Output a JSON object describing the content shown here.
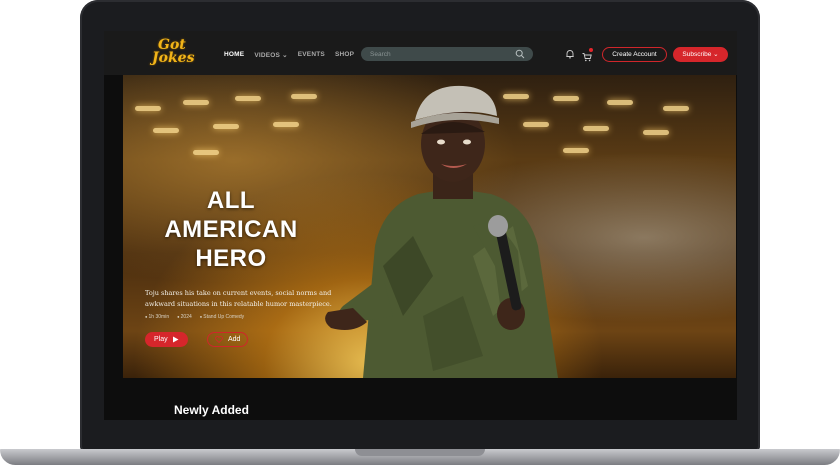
{
  "brand": {
    "logo_line1": "Got",
    "logo_line2": "Jokes"
  },
  "nav": {
    "items": [
      {
        "label": "HOME",
        "active": true
      },
      {
        "label": "VIDEOS ⌄",
        "active": false
      },
      {
        "label": "EVENTS",
        "active": false
      },
      {
        "label": "SHOP",
        "active": false
      }
    ]
  },
  "search": {
    "placeholder": "Search"
  },
  "header": {
    "create_account_label": "Create Account",
    "subscribe_label": "Subscribe ⌄",
    "icons": [
      "bell-icon",
      "cart-icon",
      "search-icon"
    ]
  },
  "hero": {
    "title_lines": [
      "ALL",
      "AMERICAN",
      "HERO"
    ],
    "description": "Toju shares his take on current events, social norms and awkward situations in this relatable humor masterpiece.",
    "meta": [
      "1h 30min",
      "2024",
      "Stand Up Comedy"
    ],
    "play_label": "Play",
    "add_label": "Add"
  },
  "sections": {
    "newly_added": "Newly Added"
  },
  "colors": {
    "accent": "#d6262b",
    "header_bg": "#1a1a1a",
    "logo": "#f2b519"
  }
}
